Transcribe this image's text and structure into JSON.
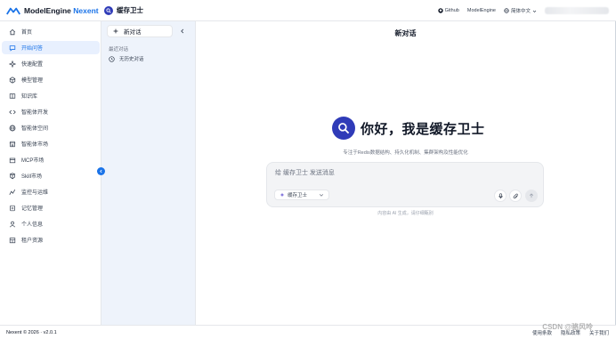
{
  "brand": {
    "name_part1": "ModelEngine",
    "name_part2": "Nexent"
  },
  "header": {
    "agent_title": "缓存卫士",
    "links": [
      {
        "label": "Github",
        "icon": "github-icon"
      },
      {
        "label": "ModelEngine",
        "icon": ""
      },
      {
        "label": "简体中文",
        "icon": "globe-icon"
      }
    ]
  },
  "nav": {
    "items": [
      {
        "label": "首页",
        "icon": "home-icon",
        "active": false
      },
      {
        "label": "开始问答",
        "icon": "chat-icon",
        "active": true
      },
      {
        "label": "快速配置",
        "icon": "sparkle-icon",
        "active": false
      },
      {
        "label": "模型管理",
        "icon": "cube-icon",
        "active": false
      },
      {
        "label": "知识库",
        "icon": "book-icon",
        "active": false
      },
      {
        "label": "智能体开发",
        "icon": "code-icon",
        "active": false
      },
      {
        "label": "智能体空间",
        "icon": "globe-icon",
        "active": false
      },
      {
        "label": "智能体市场",
        "icon": "store-icon",
        "active": false
      },
      {
        "label": "MCP市场",
        "icon": "box-icon",
        "active": false
      },
      {
        "label": "Skill市场",
        "icon": "puzzle-icon",
        "active": false
      },
      {
        "label": "监控与运维",
        "icon": "pulse-icon",
        "active": false
      },
      {
        "label": "记忆管理",
        "icon": "memory-icon",
        "active": false
      },
      {
        "label": "个人信息",
        "icon": "user-icon",
        "active": false
      },
      {
        "label": "租户资源",
        "icon": "tenant-icon",
        "active": false
      }
    ]
  },
  "conversations": {
    "new_chat_label": "新对话",
    "section_label": "最近对话",
    "history_empty": "无历史对话"
  },
  "main": {
    "title": "新对话",
    "greeting": "你好，我是缓存卫士",
    "subtitle": "专注于Redis数据结构、持久化机制、集群架构及性能优化",
    "input_placeholder": "给 缓存卫士 发送消息",
    "selected_agent": "缓存卫士",
    "disclaimer": "内容由 AI 生成，请仔细甄别"
  },
  "footer": {
    "copyright": "Nexent © 2026 · v2.0.1",
    "links": [
      "使用条款",
      "隐私政策",
      "关于我们"
    ],
    "watermark": "CSDN @骆风呤"
  },
  "colors": {
    "accent": "#1a73e8",
    "agent_avatar": "#2f3bb8",
    "conv_bg": "#eef3fb"
  }
}
